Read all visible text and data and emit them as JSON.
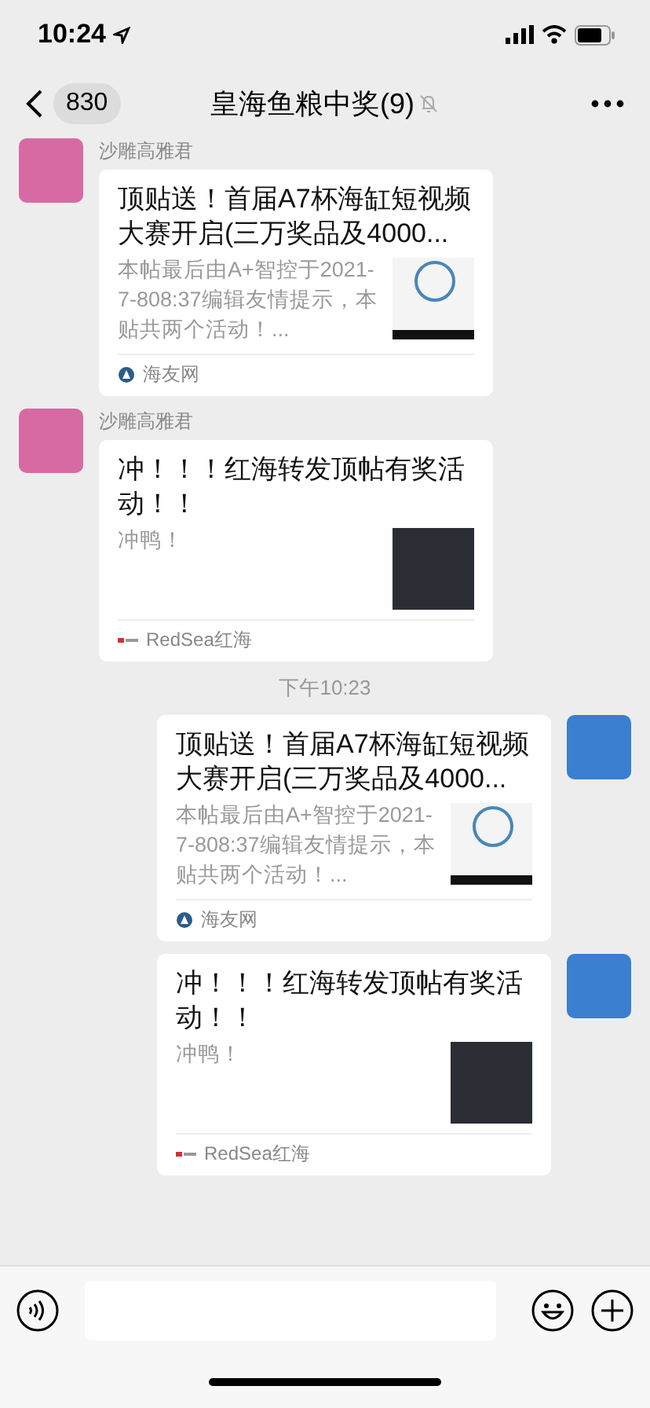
{
  "status_bar": {
    "time": "10:24"
  },
  "nav": {
    "back_count": "830",
    "title": "皇海鱼粮中奖(9)",
    "muted": true
  },
  "messages": [
    {
      "kind": "incoming",
      "sender": "沙雕高雅君",
      "title": "顶贴送！首届A7杯海缸短视频大赛开启(三万奖品及4000...",
      "desc": "本帖最后由A+智控于2021-7-808:37编辑友情提示，本贴共两个活动！...",
      "thumbnail": {
        "kind": "poster"
      },
      "source": "海友网",
      "source_logo": {
        "kind": "circle"
      }
    },
    {
      "kind": "incoming",
      "sender": "沙雕高雅君",
      "title": "冲！！！红海转发顶帖有奖活动！！",
      "desc": "冲鸭！",
      "thumbnail": {
        "kind": "dark"
      },
      "source": "RedSea红海",
      "source_logo": {
        "kind": "bar"
      }
    },
    {
      "kind": "time",
      "text": "下午10:23"
    },
    {
      "kind": "outgoing",
      "title": "顶贴送！首届A7杯海缸短视频大赛开启(三万奖品及4000...",
      "desc": "本帖最后由A+智控于2021-7-808:37编辑友情提示，本贴共两个活动！...",
      "thumbnail": {
        "kind": "poster"
      },
      "source": "海友网",
      "source_logo": {
        "kind": "circle"
      }
    },
    {
      "kind": "outgoing",
      "title": "冲！！！红海转发顶帖有奖活动！！",
      "desc": "冲鸭！",
      "thumbnail": {
        "kind": "dark"
      },
      "source": "RedSea红海",
      "source_logo": {
        "kind": "bar"
      }
    }
  ]
}
